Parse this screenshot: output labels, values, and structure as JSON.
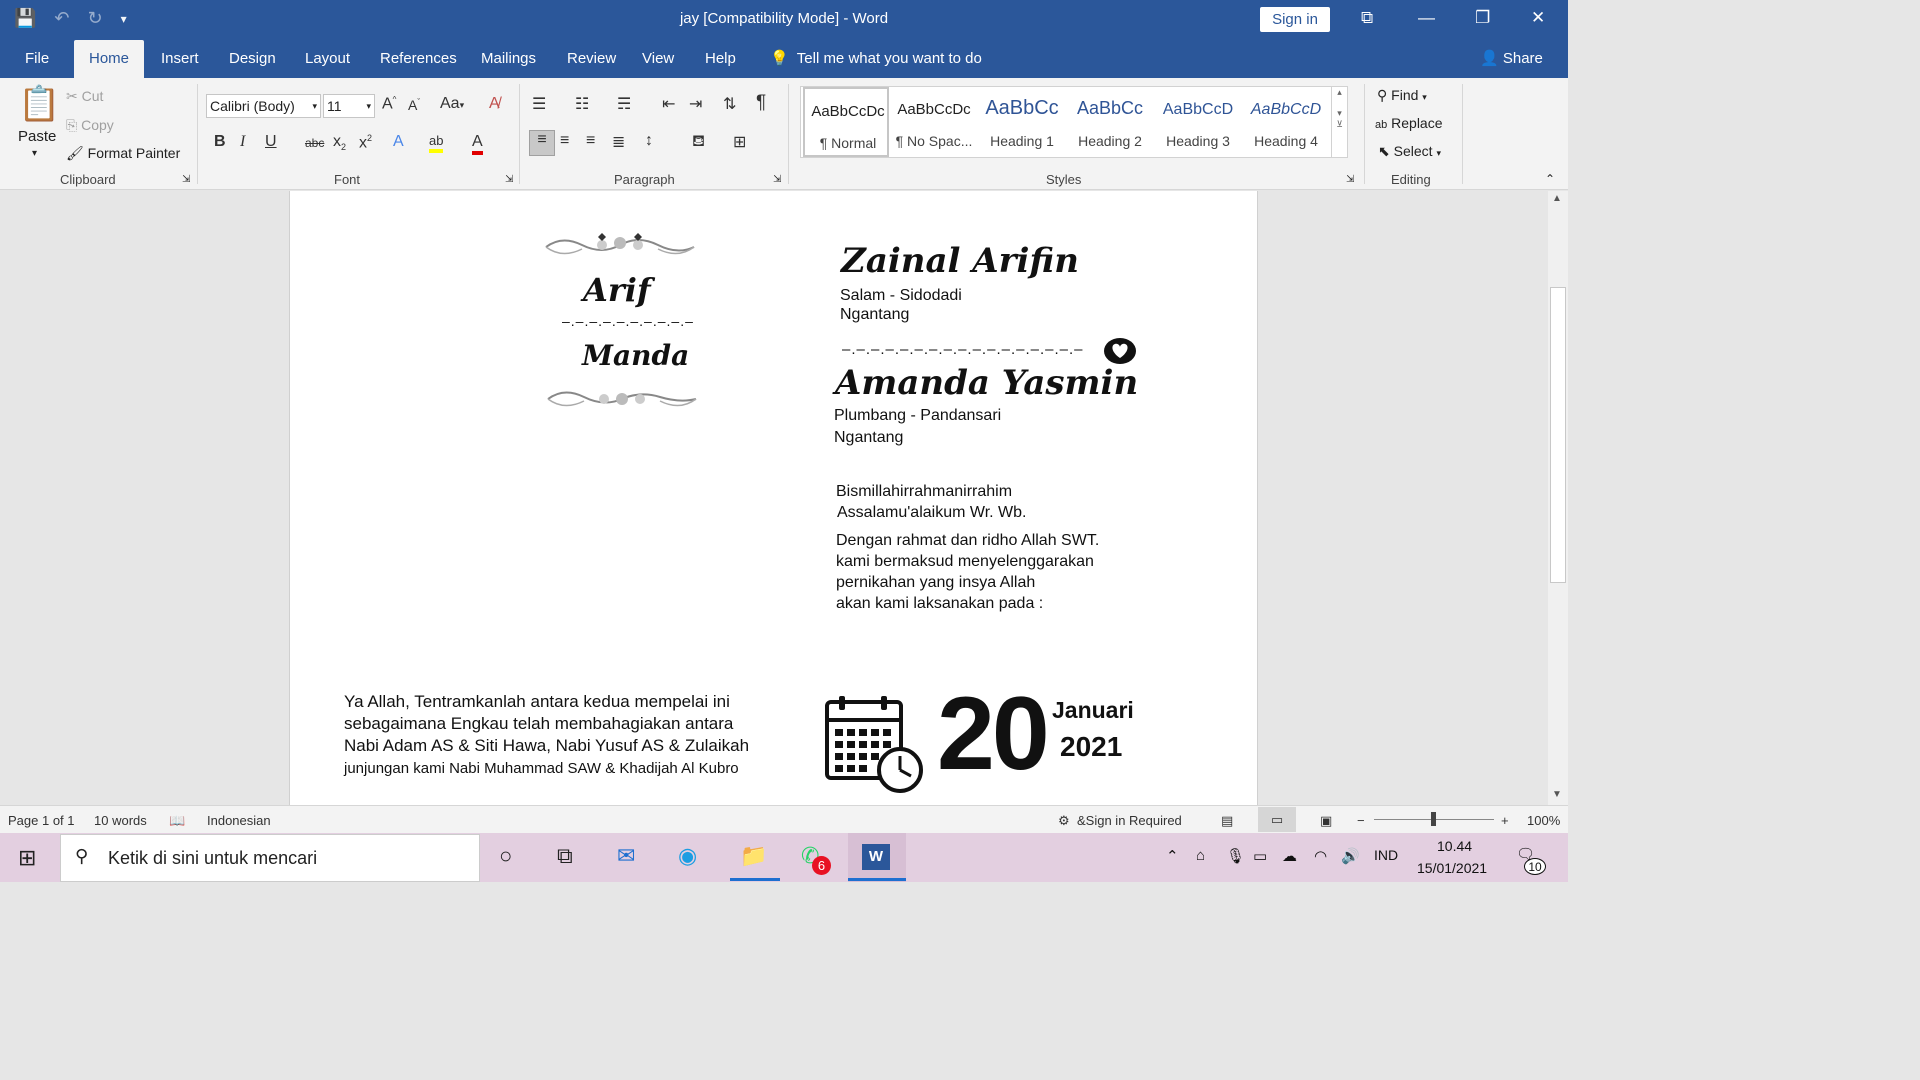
{
  "window": {
    "title": "jay [Compatibility Mode]  -  Word",
    "sign_in": "Sign in"
  },
  "tabs": {
    "file": "File",
    "home": "Home",
    "insert": "Insert",
    "design": "Design",
    "layout": "Layout",
    "references": "References",
    "mailings": "Mailings",
    "review": "Review",
    "view": "View",
    "help": "Help",
    "tell_me": "Tell me what you want to do",
    "share": "Share"
  },
  "clipboard": {
    "paste": "Paste",
    "cut": "Cut",
    "copy": "Copy",
    "format_painter": "Format Painter",
    "label": "Clipboard"
  },
  "font": {
    "name": "Calibri (Body)",
    "size": "11",
    "label": "Font",
    "case": "Aa"
  },
  "paragraph": {
    "label": "Paragraph"
  },
  "styles": {
    "label": "Styles",
    "items": [
      {
        "sample": "AaBbCcDc",
        "name": "¶ Normal"
      },
      {
        "sample": "AaBbCcDc",
        "name": "¶ No Spac..."
      },
      {
        "sample": "AaBbCc",
        "name": "Heading 1"
      },
      {
        "sample": "AaBbCc",
        "name": "Heading 2"
      },
      {
        "sample": "AaBbCcD",
        "name": "Heading 3"
      },
      {
        "sample": "AaBbCcD",
        "name": "Heading 4"
      }
    ]
  },
  "editing": {
    "find": "Find",
    "replace": "Replace",
    "select": "Select",
    "label": "Editing"
  },
  "document": {
    "monogram_top": "Arif",
    "monogram_bottom": "Manda",
    "groom_name": "Zainal Arifin",
    "groom_addr1": "Salam - Sidodadi",
    "groom_addr2": "Ngantang",
    "bride_name": "Amanda Yasmin",
    "bride_addr1": "Plumbang - Pandansari",
    "bride_addr2": "Ngantang",
    "greet1": "Bismillahirrahmanirrahim",
    "greet2": "Assalamu'alaikum Wr. Wb.",
    "body1": "Dengan rahmat dan ridho Allah SWT.",
    "body2": "kami bermaksud menyelenggarakan",
    "body3": "pernikahan yang insya Allah",
    "body4": "akan kami laksanakan pada :",
    "prayer1": "Ya Allah, Tentramkanlah antara kedua mempelai ini",
    "prayer2": "sebagaimana Engkau telah membahagiakan antara",
    "prayer3": "Nabi Adam AS & Siti Hawa, Nabi Yusuf AS & Zulaikah",
    "prayer4": "junjungan kami Nabi Muhammad SAW & Khadijah Al Kubro",
    "day": "20",
    "month": "Januari",
    "year": "2021"
  },
  "statusbar": {
    "page": "Page 1 of 1",
    "words": "10 words",
    "language": "Indonesian",
    "sign": "&Sign in Required",
    "zoom": "100%"
  },
  "taskbar": {
    "search_placeholder": "Ketik di sini untuk mencari",
    "whatsapp_badge": "6",
    "lang": "IND",
    "time": "10.44",
    "date": "15/01/2021",
    "notif_count": "10"
  }
}
